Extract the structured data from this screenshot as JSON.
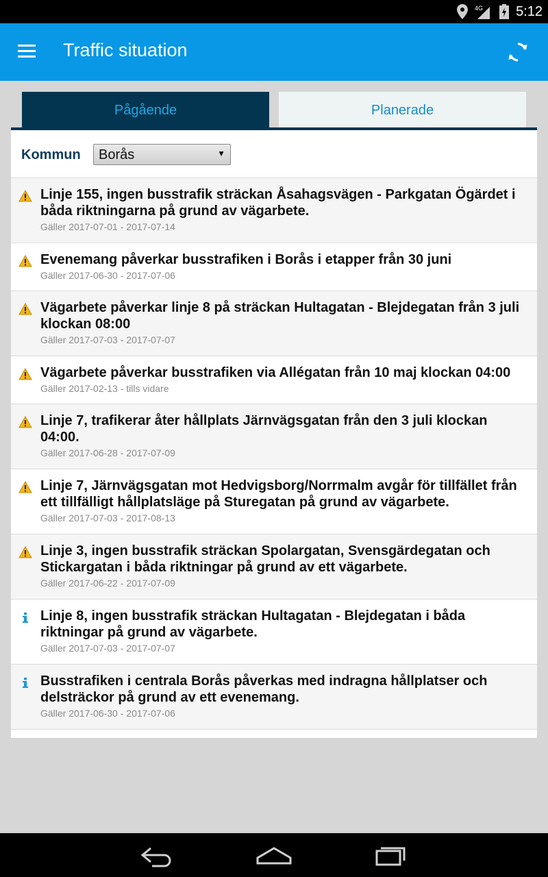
{
  "status_bar": {
    "time": "5:12",
    "network": "4G"
  },
  "app_bar": {
    "title": "Traffic situation",
    "menu_icon": "hamburger-menu-icon",
    "refresh_icon": "refresh-icon",
    "color": "#0898e6"
  },
  "tabs": [
    {
      "label": "Pågående",
      "active": true
    },
    {
      "label": "Planerade",
      "active": false
    }
  ],
  "filter": {
    "label": "Kommun",
    "selected": "Borås"
  },
  "items": [
    {
      "icon": "warning-icon",
      "title": "Linje 155, ingen busstrafik sträckan Åsahagsvägen - Parkgatan Ögärdet i båda riktningarna på grund av vägarbete.",
      "date": "Gäller 2017-07-01 - 2017-07-14"
    },
    {
      "icon": "warning-icon",
      "title": "Evenemang påverkar busstrafiken i Borås i etapper från 30 juni",
      "date": "Gäller 2017-06-30 - 2017-07-06"
    },
    {
      "icon": "warning-icon",
      "title": "Vägarbete påverkar linje 8 på sträckan Hultagatan - Blejdegatan från 3 juli klockan 08:00",
      "date": "Gäller 2017-07-03 - 2017-07-07"
    },
    {
      "icon": "warning-icon",
      "title": "Vägarbete påverkar busstrafiken via Allégatan från 10 maj klockan 04:00",
      "date": "Gäller 2017-02-13 - tills vidare"
    },
    {
      "icon": "warning-icon",
      "title": "Linje 7, trafikerar åter hållplats Järnvägsgatan från den 3 juli klockan 04:00.",
      "date": "Gäller 2017-06-28 - 2017-07-09"
    },
    {
      "icon": "warning-icon",
      "title": "Linje 7, Järnvägsgatan mot Hedvigsborg/Norrmalm avgår för tillfället från ett tillfälligt hållplatsläge på Sturegatan på grund av vägarbete.",
      "date": "Gäller 2017-07-03 - 2017-08-13"
    },
    {
      "icon": "warning-icon",
      "title": "Linje 3, ingen busstrafik sträckan Spolargatan, Svensgärdegatan och Stickargatan i båda riktningar på grund av ett vägarbete.",
      "date": "Gäller 2017-06-22 - 2017-07-09"
    },
    {
      "icon": "info-icon",
      "title": "Linje 8, ingen busstrafik sträckan Hultagatan - Blejdegatan i båda riktningar på grund av vägarbete.",
      "date": "Gäller 2017-07-03 - 2017-07-07"
    },
    {
      "icon": "info-icon",
      "title": "Busstrafiken i centrala Borås påverkas med indragna hållplatser och delsträckor på grund av ett evenemang.",
      "date": "Gäller 2017-06-30 - 2017-07-06"
    }
  ],
  "nav_bar": {
    "back_icon": "back-icon",
    "home_icon": "home-icon",
    "recents_icon": "recents-icon"
  }
}
